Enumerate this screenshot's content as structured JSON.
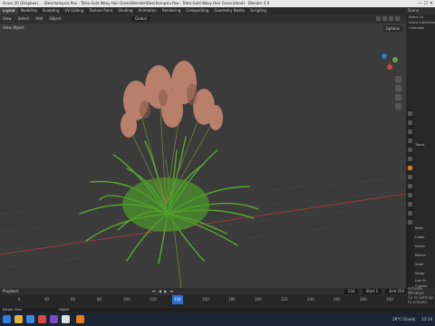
{
  "window": {
    "title": "Grass 20 (Dropbox) ... \\Deschampsia flex - Tetra Gold Wavy Hair Grass\\Blender\\Deschampsia flex - Tetra Gold Wavy Hair Grass.blend] - Blender 4.0"
  },
  "menubar": {
    "tabs": [
      "Layout",
      "Modeling",
      "Sculpting",
      "UV Editing",
      "Texture Paint",
      "Shading",
      "Animation",
      "Rendering",
      "Compositing",
      "Geometry Nodes",
      "Scripting"
    ],
    "active_tab": "Layout",
    "scene_label": "Scene"
  },
  "viewport_header": {
    "view": "View",
    "select": "Select",
    "add": "Add",
    "object": "Object",
    "orientation": "Global",
    "options_label": "Options"
  },
  "viewport_tools": {
    "view": "View",
    "object": "Object"
  },
  "outliner": {
    "title": "Scene Co",
    "rows": [
      "Scene Collection",
      "Collection"
    ]
  },
  "properties": {
    "rows": [
      "Transf",
      "Relat",
      "Collec",
      "Instan",
      "Motion",
      "Visibi",
      "Viewp",
      "Line Ar",
      "Custom"
    ]
  },
  "timeline": {
    "frame_ticks": [
      "0",
      "40",
      "60",
      "80",
      "100",
      "120",
      "140",
      "160",
      "180",
      "200",
      "220",
      "240",
      "260",
      "280",
      "300"
    ],
    "current_frame": "154",
    "start_label": "Start",
    "start": "1",
    "end_label": "End",
    "end": "250",
    "play_label": "Playback"
  },
  "statusbar": {
    "left": "Rotate View",
    "right": "Object"
  },
  "watermark": {
    "line1": "Activate Windows",
    "line2": "Go to Settings to activate"
  },
  "taskbar": {
    "weather": "29°C  Cloudy",
    "time": "12:14"
  },
  "colors": {
    "viewport_bg": "#3b3b3b",
    "grass_green": "#5aa630",
    "seed_head": "#b8806a",
    "grid_red": "#b03a3a",
    "grid_green": "#5f8f2a",
    "active_blue": "#2f6fd2"
  }
}
